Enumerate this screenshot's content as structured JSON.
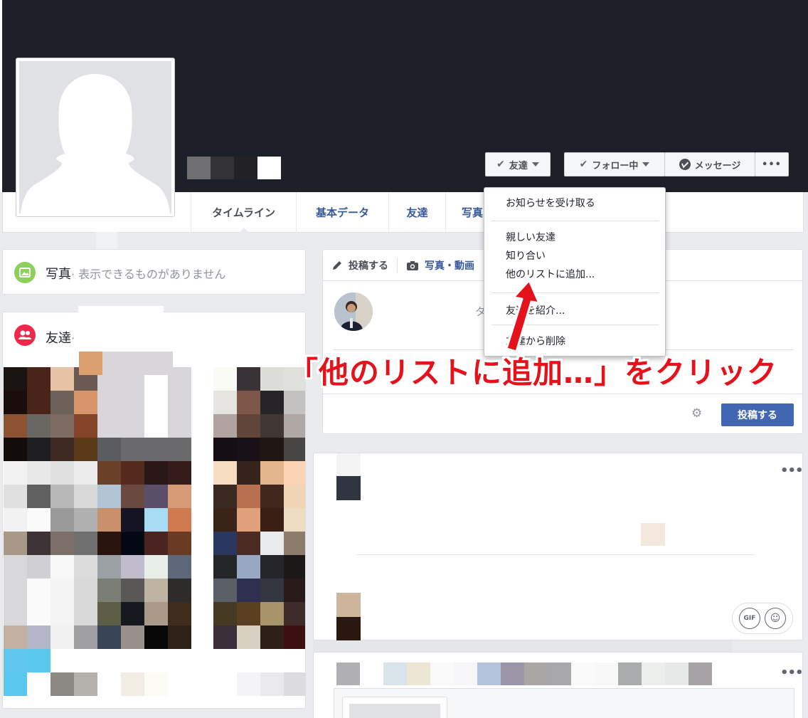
{
  "buttons": {
    "friends": "友達",
    "following": "フォロー中",
    "message": "メッセージ",
    "more": "•••"
  },
  "tabs": [
    {
      "label": "タイムライン"
    },
    {
      "label": "基本データ"
    },
    {
      "label": "友達"
    },
    {
      "label": "写真"
    }
  ],
  "photos_section": {
    "title": "写真",
    "subtitle": "· 表示できるものがありません"
  },
  "friends_section": {
    "title": "友達",
    "subtitle": "·"
  },
  "composer": {
    "tab_post": "投稿する",
    "tab_photo": "写真・動画",
    "placeholder_fragment": "タ",
    "submit_label": "投稿する"
  },
  "dropdown": {
    "items": [
      "お知らせを受け取る",
      "親しい友達",
      "知り合い",
      "他のリストに追加...",
      "友達を紹介...",
      "友達から削除"
    ]
  },
  "annotation": {
    "text": "「他のリストに追加…」をクリック"
  },
  "comment_icons": {
    "gif": "GIF"
  },
  "colors": {
    "cover": "#1d2029",
    "link": "#365899",
    "primary_button": "#4267b2",
    "annotation": "#e3121b",
    "photos_icon": "#8ad05a",
    "friends_icon": "#f02849"
  },
  "icons": {
    "check": "check-icon",
    "caret": "caret-down-icon",
    "messenger": "messenger-icon",
    "pencil": "pencil-icon",
    "camera": "camera-icon",
    "gear": "gear-icon",
    "photo": "photo-icon",
    "friends": "friends-icon",
    "sticker": "sticker-icon"
  }
}
